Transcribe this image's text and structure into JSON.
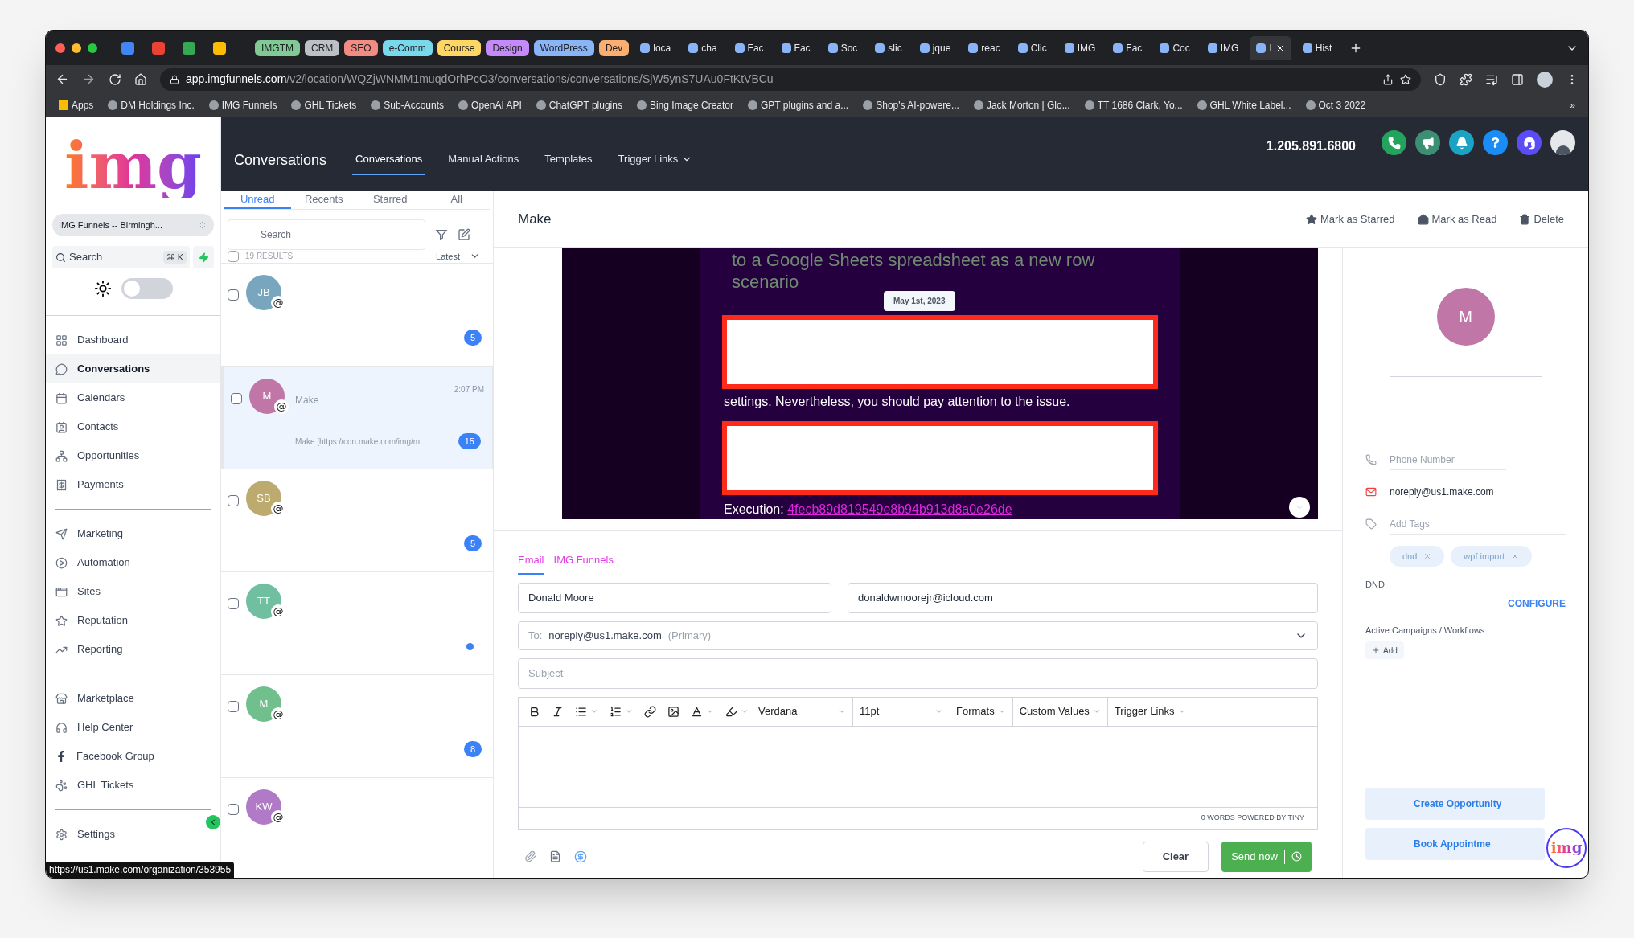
{
  "browser": {
    "tab_groups": [
      {
        "label": "IMGTM",
        "color": "#81c995"
      },
      {
        "label": "CRM",
        "color": "#bdc1c6"
      },
      {
        "label": "SEO",
        "color": "#f28b82"
      },
      {
        "label": "e-Comm",
        "color": "#78d9ec"
      },
      {
        "label": "Course",
        "color": "#fdd663"
      },
      {
        "label": "Design",
        "color": "#c58af9"
      },
      {
        "label": "WordPress",
        "color": "#8ab4f8"
      },
      {
        "label": "Dev",
        "color": "#fcad70"
      }
    ],
    "tabs": [
      {
        "title": "loca",
        "selected": false
      },
      {
        "title": "cha",
        "selected": false
      },
      {
        "title": "Fac",
        "selected": false
      },
      {
        "title": "Fac",
        "selected": false
      },
      {
        "title": "Soc",
        "selected": false
      },
      {
        "title": "slic",
        "selected": false
      },
      {
        "title": "jque",
        "selected": false
      },
      {
        "title": "reac",
        "selected": false
      },
      {
        "title": "Clic",
        "selected": false
      },
      {
        "title": "IMG",
        "selected": false
      },
      {
        "title": "Fac",
        "selected": false
      },
      {
        "title": "Coc",
        "selected": false
      },
      {
        "title": "IMG",
        "selected": false
      },
      {
        "title": "I",
        "selected": true
      },
      {
        "title": "Hist",
        "selected": false
      }
    ],
    "url_domain": "app.imgfunnels.com",
    "url_path": "/v2/location/WQZjWNMM1muqdOrhPcO3/conversations/conversations/SjW5ynS7UAu0FtKtVBCu",
    "bookmarks": [
      "Apps",
      "DM Holdings Inc.",
      "IMG Funnels",
      "GHL Tickets",
      "Sub-Accounts",
      "OpenAI API",
      "ChatGPT plugins",
      "Bing Image Creator",
      "GPT plugins and a...",
      "Shop's AI-powere...",
      "Jack Morton | Glo...",
      "TT 1686 Clark, Yo...",
      "GHL White Label...",
      "Oct 3 2022"
    ],
    "more_bookmarks": "»",
    "status_url": "https://us1.make.com/organization/353955"
  },
  "sidebar": {
    "logo": "img",
    "location": "IMG Funnels -- Birmingh...",
    "search": "Search",
    "shortcut": "⌘ K",
    "dark_mode": false,
    "sections": [
      [
        {
          "label": "Dashboard",
          "selected": false
        },
        {
          "label": "Conversations",
          "selected": true
        },
        {
          "label": "Calendars",
          "selected": false
        },
        {
          "label": "Contacts",
          "selected": false
        },
        {
          "label": "Opportunities",
          "selected": false
        },
        {
          "label": "Payments",
          "selected": false
        }
      ],
      [
        {
          "label": "Marketing",
          "selected": false
        },
        {
          "label": "Automation",
          "selected": false
        },
        {
          "label": "Sites",
          "selected": false
        },
        {
          "label": "Reputation",
          "selected": false
        },
        {
          "label": "Reporting",
          "selected": false
        }
      ],
      [
        {
          "label": "Marketplace",
          "selected": false
        },
        {
          "label": "Help Center",
          "selected": false
        },
        {
          "label": "Facebook Group",
          "selected": false
        },
        {
          "label": "GHL Tickets",
          "selected": false
        }
      ],
      [
        {
          "label": "Settings",
          "selected": false
        }
      ]
    ]
  },
  "header": {
    "title": "Conversations",
    "nav": [
      {
        "label": "Conversations",
        "selected": true
      },
      {
        "label": "Manual Actions",
        "selected": false
      },
      {
        "label": "Templates",
        "selected": false
      },
      {
        "label": "Trigger Links",
        "selected": false
      }
    ],
    "phone": "1.205.891.6800"
  },
  "conversation_list": {
    "tabs": [
      {
        "label": "Unread",
        "selected": true
      },
      {
        "label": "Recents",
        "selected": false
      },
      {
        "label": "Starred",
        "selected": false
      },
      {
        "label": "All",
        "selected": false
      }
    ],
    "search_placeholder": "Search",
    "results": "19 RESULTS",
    "sort": "Latest",
    "select_all_checked": false,
    "rows": [
      {
        "initials": "JB",
        "channel": "@",
        "color": "#79a6bf",
        "selected": false,
        "checked": false,
        "badge": "5"
      },
      {
        "initials": "M",
        "channel": "@",
        "color": "#c077a8",
        "selected": true,
        "checked": false,
        "name": "Make",
        "time": "2:07 PM",
        "preview": "Make [https://cdn.make.com/img/m",
        "badge": "15"
      },
      {
        "initials": "SB",
        "channel": "@",
        "color": "#bcaa6e",
        "selected": false,
        "checked": false,
        "badge": "5"
      },
      {
        "initials": "TT",
        "channel": "@",
        "color": "#70bfa0",
        "selected": false,
        "checked": false,
        "dot": true
      },
      {
        "initials": "M",
        "channel": "@",
        "color": "#72bf8e",
        "selected": false,
        "checked": false,
        "badge": "8"
      },
      {
        "initials": "KW",
        "channel": "@",
        "color": "#b07ac6",
        "selected": false,
        "checked": false
      }
    ]
  },
  "conversation": {
    "title": "Make",
    "actions": [
      "Mark as Starred",
      "Mark as Read",
      "Delete"
    ],
    "message": {
      "heading": "to a Google Sheets spreadsheet as a new row scenario",
      "date": "May 1st, 2023",
      "body": "settings. Nevertheless, you should pay attention to the issue.",
      "execution_label": "Execution:",
      "execution_id": "4fecb89d819549e8b94b913d8a0e26de"
    },
    "composer": {
      "tabs": [
        {
          "label": "Email",
          "selected": true
        },
        {
          "label": "IMG Funnels",
          "selected": false
        }
      ],
      "from_name": "Donald Moore",
      "from_email": "donaldwmoorejr@icloud.com",
      "to_label": "To:",
      "to": "noreply@us1.make.com",
      "to_note": "(Primary)",
      "subject_placeholder": "Subject",
      "font": "Verdana",
      "size": "11pt",
      "menus": [
        "Formats",
        "Custom Values",
        "Trigger Links"
      ],
      "footer": "0 WORDS POWERED BY TINY",
      "clear": "Clear",
      "send": "Send now"
    }
  },
  "contact": {
    "initial": "M",
    "phone_placeholder": "Phone Number",
    "email": "noreply@us1.make.com",
    "tags_placeholder": "Add Tags",
    "tags": [
      "dnd",
      "wpf import"
    ],
    "dnd_label": "DND",
    "configure": "CONFIGURE",
    "campaigns_label": "Active Campaigns / Workflows",
    "add": "Add",
    "buttons": [
      "Create Opportunity",
      "Book Appointme"
    ]
  },
  "floating_logo": "img"
}
